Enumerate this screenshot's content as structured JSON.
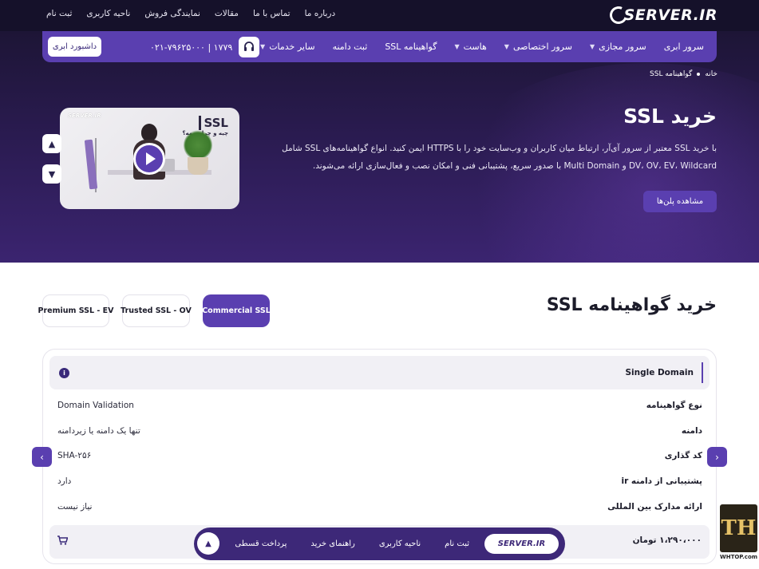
{
  "topbar": {
    "logo": "SERVER.IR",
    "links": [
      "درباره ما",
      "تماس با ما",
      "مقالات",
      "نمایندگی فروش",
      "ناحیه کاربری",
      "ثبت نام"
    ]
  },
  "nav": {
    "items": [
      {
        "label": "سرور ابری",
        "dropdown": false
      },
      {
        "label": "سرور مجازی",
        "dropdown": true
      },
      {
        "label": "سرور اختصاصی",
        "dropdown": true
      },
      {
        "label": "هاست",
        "dropdown": true
      },
      {
        "label": "گواهینامه SSL",
        "dropdown": false
      },
      {
        "label": "ثبت دامنه",
        "dropdown": false
      },
      {
        "label": "سایر خدمات",
        "dropdown": true
      }
    ],
    "phone": "۰۲۱-۷۹۶۲۵۰۰۰ | ۱۷۷۹",
    "dashboard": "داشبورد ابری"
  },
  "breadcrumb": {
    "home": "خانه",
    "current": "گواهینامه SSL"
  },
  "hero": {
    "title": "خرید SSL",
    "description": "با خرید SSL معتبر از سرور آی‌آر، ارتباط میان کاربران و وب‌سایت خود را با HTTPS ایمن کنید. انواع گواهینامه‌های SSL شامل DV، OV، EV، Wildcard و Multi Domain با صدور سریع، پشتیبانی فنی و امکان نصب و فعال‌سازی ارائه می‌شوند.",
    "cta": "مشاهده پلن‌ها",
    "video": {
      "logo": "SERVER.IR",
      "title": "SSL",
      "subtitle": "چیه و چرا مهمه؟"
    }
  },
  "section": {
    "title": "خرید گواهینامه SSL",
    "tabs": [
      {
        "label": "Commercial SSL",
        "active": true
      },
      {
        "label": "Trusted SSL - OV",
        "active": false
      },
      {
        "label": "Premium SSL - EV",
        "active": false
      }
    ]
  },
  "plan": {
    "name": "Single Domain",
    "rows": [
      {
        "label": "نوع گواهینامه",
        "value": "Domain Validation"
      },
      {
        "label": "دامنه",
        "value": "تنها یک دامنه یا زیردامنه"
      },
      {
        "label": "کد گذاری",
        "value": "SHA-۲۵۶"
      },
      {
        "label": "پشتیبانی از دامنه ir",
        "value": "دارد"
      },
      {
        "label": "ارائه مدارک بین المللی",
        "value": "نیاز نیست"
      }
    ],
    "price": "۱،۲۹۰،۰۰۰ تومان"
  },
  "floating_nav": {
    "logo": "SERVER.IR",
    "items": [
      "ثبت نام",
      "ناحیه کاربری",
      "راهنمای خرید",
      "پرداخت قسطی"
    ]
  },
  "watermark": {
    "mark": "TH",
    "text": "WHTOP.com"
  },
  "colors": {
    "primary": "#5a3fb0",
    "dark": "#15112a",
    "hero_end": "#3b2470"
  }
}
